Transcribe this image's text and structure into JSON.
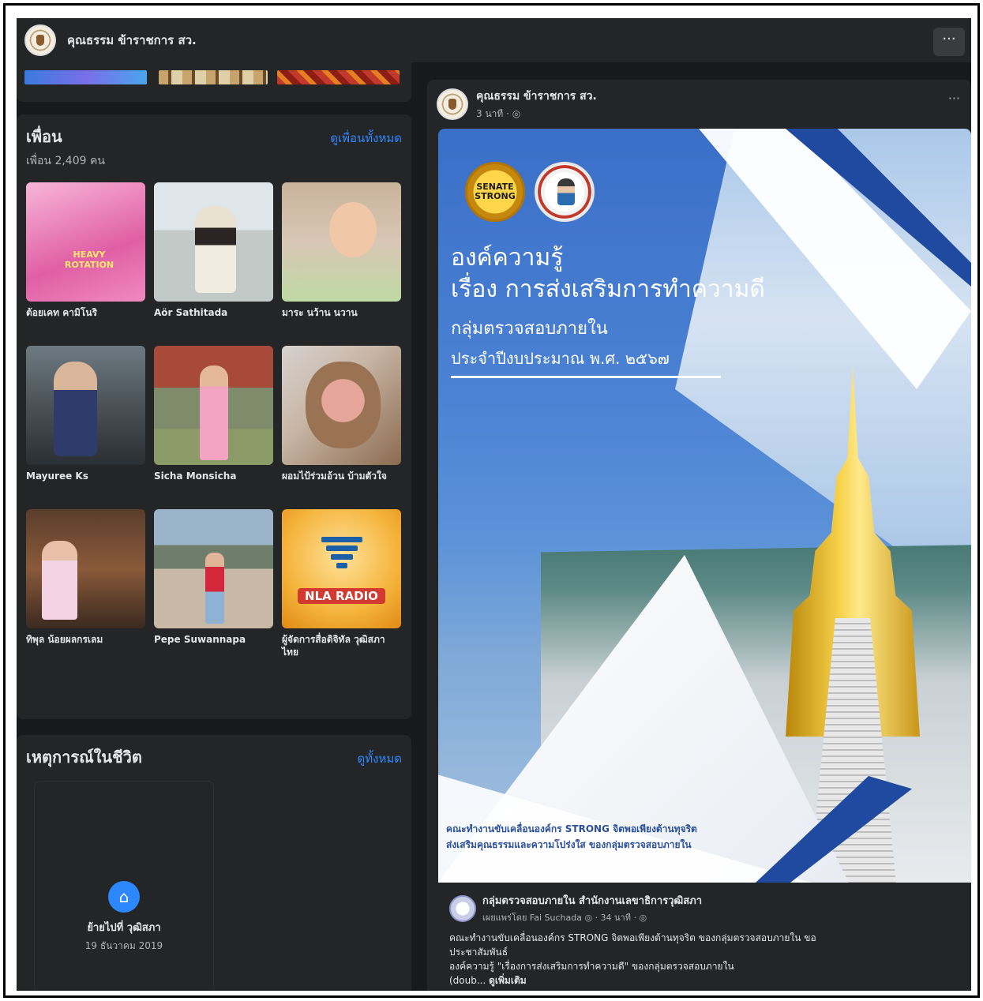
{
  "topbar": {
    "page_name": "คุณธรรม ข้าราชการ สว.",
    "more_label": "···"
  },
  "friends": {
    "title": "เพื่อน",
    "see_all": "ดูเพื่อนทั้งหมด",
    "count_text": "เพื่อน 2,409 คน",
    "items": [
      {
        "name": "ต้อยเคท คามิโนริ"
      },
      {
        "name": "Aör Sathitada"
      },
      {
        "name": "มาระ นว้าน นวาน"
      },
      {
        "name": "Mayuree Ks"
      },
      {
        "name": "Sicha Monsicha"
      },
      {
        "name": "ผอมไป้ร่วมอ้วน บ้ามตัวใจ"
      },
      {
        "name": "ทิพุล น้อยผลกรเลม"
      },
      {
        "name": "Pepe Suwannapa"
      },
      {
        "name": "ผู้จัดการสื่อดิจิทัล วุฒิสภาไทย"
      }
    ],
    "nla_text": "NLA RADIO"
  },
  "life_events": {
    "title": "เหตุการณ์ในชีวิต",
    "see_all": "ดูทั้งหมด",
    "event_title": "ย้ายไปที่ วุฒิสภา",
    "event_date": "19 ธันวาคม 2019",
    "icon": "home-icon"
  },
  "post": {
    "author": "คุณธรรม ข้าราชการ สว.",
    "time": "3 นาที · ◎",
    "more_label": "···",
    "banner": {
      "badge1_text": "SENATE STRONG",
      "title_line1": "องค์ความรู้",
      "title_line2": "เรื่อง การส่งเสริมการทำความดี",
      "subtitle": "กลุ่มตรวจสอบภายใน",
      "year": "ประจำปีงบประมาณ พ.ศ. ๒๕๖๗",
      "footer1": "คณะทำงานขับเคลื่อนองค์กร STRONG จิตพอเพียงต้านทุจริต",
      "footer2": "ส่งเสริมคุณธรรมและความโปร่งใส ของกลุ่มตรวจสอบภายใน"
    },
    "shared": {
      "author": "กลุ่มตรวจสอบภายใน สำนักงานเลขาธิการวุฒิสภา",
      "sub": "เผยแพร่โดย Fai Suchada ◎ · 34 นาที · ◎",
      "line1": "คณะทำงานขับเคลื่อนองค์กร STRONG จิตพอเพียงต้านทุจริต ของกลุ่มตรวจสอบภายใน ขอ",
      "line2": "ประชาสัมพันธ์",
      "line3": "องค์ความรู้ \"เรื่องการส่งเสริมการทำความดี\" ของกลุ่มตรวจสอบภายใน",
      "line4_prefix": "(doub... ",
      "see_more": "ดูเพิ่มเติม"
    }
  },
  "colors": {
    "background": "#18191a",
    "card": "#242526",
    "link": "#2d88ff",
    "text": "#e4e6eb",
    "muted": "#b0b3b8"
  }
}
